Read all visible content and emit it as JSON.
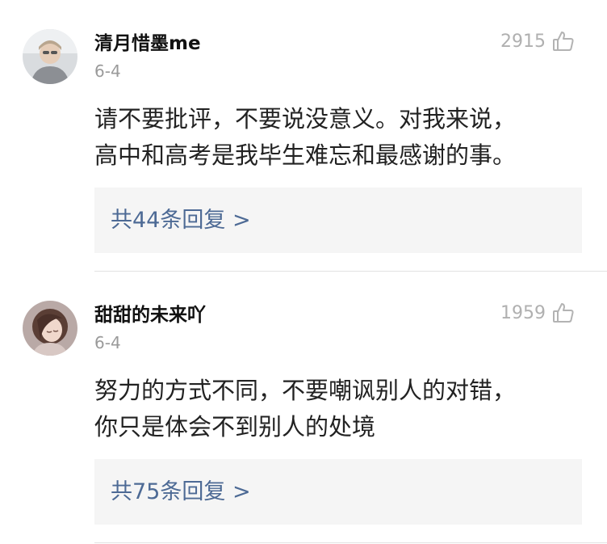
{
  "comments": [
    {
      "username": "清月惜墨me",
      "date": "6-4",
      "likes": "2915",
      "text_lines": [
        "请不要批评，不要说没意义。对我来说，",
        "高中和高考是我毕生难忘和最感谢的事。"
      ],
      "reply_link": "共44条回复 >",
      "avatar_icon": "avatar-user-photo"
    },
    {
      "username": "甜甜的未来吖",
      "date": "6-4",
      "likes": "1959",
      "text_lines": [
        "努力的方式不同，不要嘲讽别人的对错，",
        "你只是体会不到别人的处境"
      ],
      "reply_link": "共75条回复 >",
      "avatar_icon": "avatar-user-illustration"
    }
  ],
  "colors": {
    "link": "#4d6a95",
    "muted": "#9a9a9a",
    "reply_bg": "#f5f5f5"
  },
  "icons": {
    "like": "thumbs-up-icon"
  }
}
